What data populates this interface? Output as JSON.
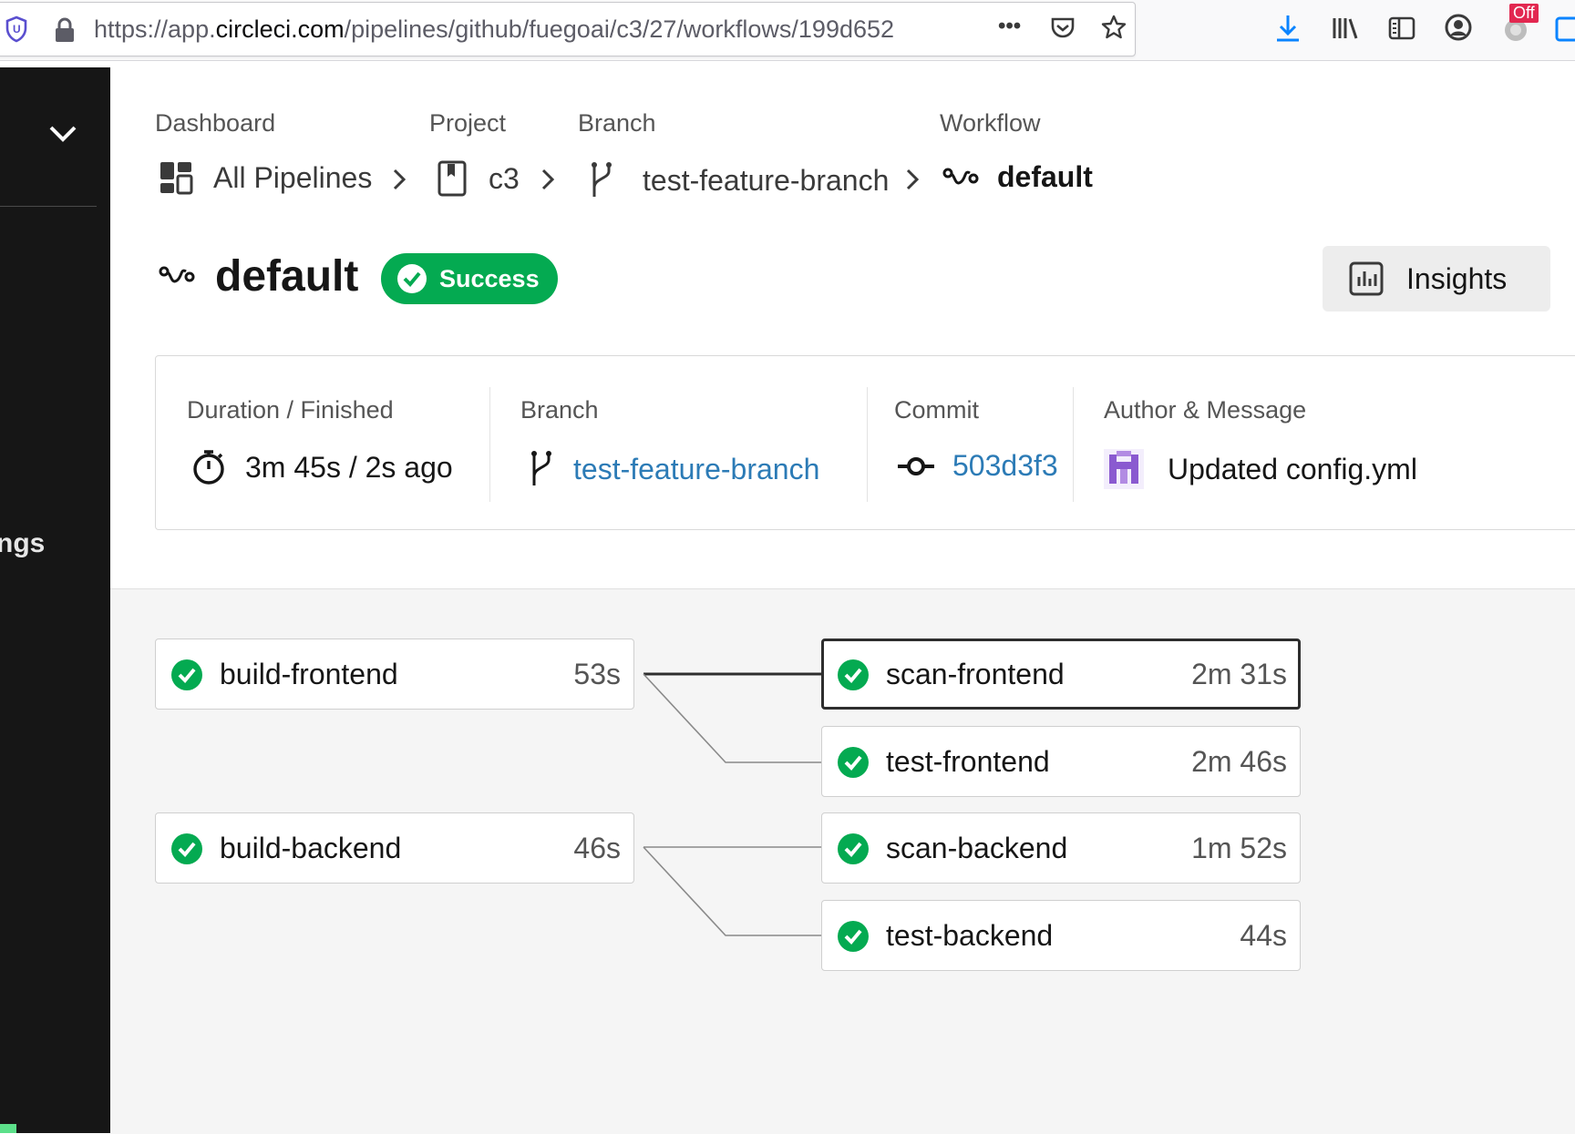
{
  "browser": {
    "url_prefix": "https://app.",
    "url_host": "circleci.com",
    "url_path": "/pipelines/github/fuegoai/c3/27/workflows/199d652",
    "more_label": "•••",
    "extension_badge": "Off"
  },
  "sidebar": {
    "partial_label": "ngs"
  },
  "breadcrumb": {
    "dashboard_label": "Dashboard",
    "dashboard_value": "All Pipelines",
    "project_label": "Project",
    "project_value": "c3",
    "branch_label": "Branch",
    "branch_value": "test-feature-branch",
    "workflow_label": "Workflow",
    "workflow_value": "default"
  },
  "header": {
    "title": "default",
    "status": "Success",
    "insights_label": "Insights"
  },
  "meta": {
    "duration_label": "Duration / Finished",
    "duration_value": "3m 45s / 2s ago",
    "branch_label": "Branch",
    "branch_value": "test-feature-branch",
    "commit_label": "Commit",
    "commit_value": "503d3f3",
    "author_label": "Author & Message",
    "author_message": "Updated config.yml"
  },
  "jobs": [
    {
      "name": "build-frontend",
      "duration": "53s",
      "status": "success"
    },
    {
      "name": "scan-frontend",
      "duration": "2m 31s",
      "status": "success",
      "selected": true
    },
    {
      "name": "test-frontend",
      "duration": "2m 46s",
      "status": "success"
    },
    {
      "name": "build-backend",
      "duration": "46s",
      "status": "success"
    },
    {
      "name": "scan-backend",
      "duration": "1m 52s",
      "status": "success"
    },
    {
      "name": "test-backend",
      "duration": "44s",
      "status": "success"
    }
  ],
  "colors": {
    "success": "#04aa51",
    "link": "#2c7bb6",
    "sidebar": "#161616"
  }
}
